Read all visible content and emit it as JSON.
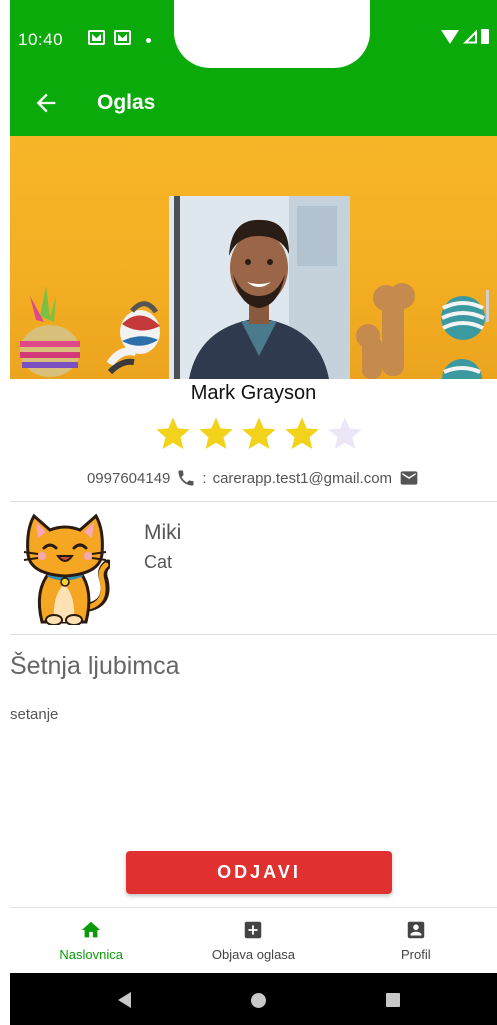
{
  "status_bar": {
    "time": "10:40"
  },
  "app_bar": {
    "title": "Oglas"
  },
  "profile": {
    "name": "Mark Grayson",
    "rating": 4,
    "rating_max": 5,
    "phone": "0997604149",
    "email_separator": ":",
    "email": "carerapp.test1@gmail.com"
  },
  "pet": {
    "name": "Miki",
    "type": "Cat"
  },
  "service": {
    "title": "Šetnja ljubimca",
    "description": "setanje"
  },
  "actions": {
    "logout_label": "ODJAVI"
  },
  "bottom_nav": {
    "items": [
      {
        "label": "Naslovnica",
        "icon": "home-icon",
        "active": true
      },
      {
        "label": "Objava oglasa",
        "icon": "add-box-icon",
        "active": false
      },
      {
        "label": "Profil",
        "icon": "account-box-icon",
        "active": false
      }
    ]
  },
  "colors": {
    "primary": "#0aaa0a",
    "accent_red": "#e03030",
    "star_filled": "#f2d21a",
    "star_empty": "#ece6f7",
    "nav_active": "#0a9a0a"
  }
}
